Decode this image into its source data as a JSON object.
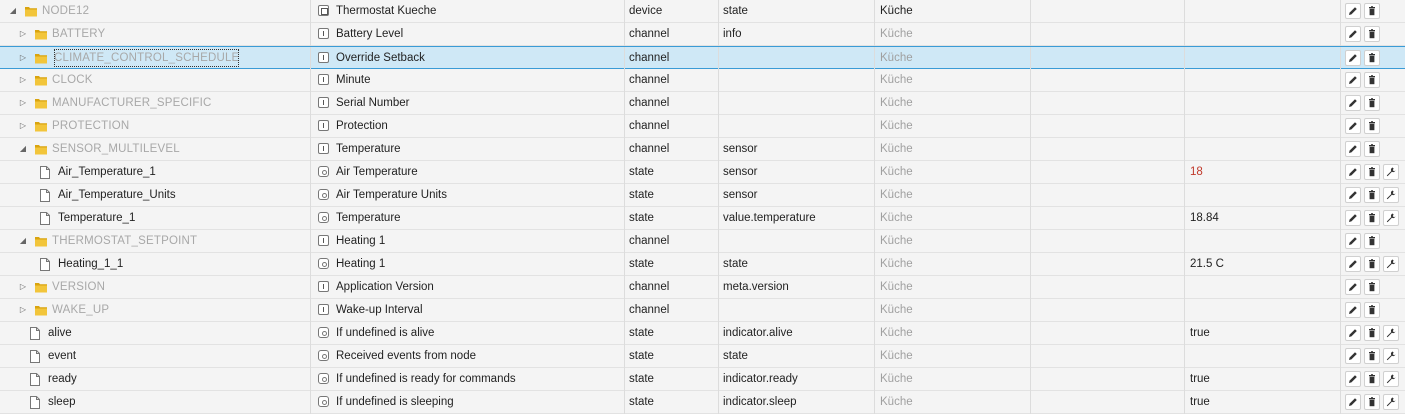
{
  "rows": [
    {
      "id": "NODE12",
      "kind": "folder",
      "level": 0,
      "toggle": "open",
      "dim": true,
      "icon": "device-icon",
      "name": "Thermostat Kueche",
      "type": "device",
      "role": "state",
      "room": "Küche",
      "room_dim": false,
      "value": "",
      "actions": [
        "edit",
        "delete"
      ]
    },
    {
      "id": "BATTERY",
      "kind": "folder",
      "level": 1,
      "toggle": "closed",
      "dim": true,
      "icon": "channel-icon",
      "name": "Battery Level",
      "type": "channel",
      "role": "info",
      "room": "Küche",
      "room_dim": true,
      "value": "",
      "actions": [
        "edit",
        "delete"
      ]
    },
    {
      "id": "CLIMATE_CONTROL_SCHEDULE",
      "kind": "folder",
      "level": 1,
      "toggle": "closed",
      "dim": true,
      "focus": true,
      "selected": true,
      "icon": "channel-icon",
      "name": "Override Setback",
      "type": "channel",
      "role": "",
      "room": "Küche",
      "room_dim": true,
      "value": "",
      "actions": [
        "edit",
        "delete"
      ]
    },
    {
      "id": "CLOCK",
      "kind": "folder",
      "level": 1,
      "toggle": "closed",
      "dim": true,
      "icon": "channel-icon",
      "name": "Minute",
      "type": "channel",
      "role": "",
      "room": "Küche",
      "room_dim": true,
      "value": "",
      "actions": [
        "edit",
        "delete"
      ]
    },
    {
      "id": "MANUFACTURER_SPECIFIC",
      "kind": "folder",
      "level": 1,
      "toggle": "closed",
      "dim": true,
      "icon": "channel-icon",
      "name": "Serial Number",
      "type": "channel",
      "role": "",
      "room": "Küche",
      "room_dim": true,
      "value": "",
      "actions": [
        "edit",
        "delete"
      ]
    },
    {
      "id": "PROTECTION",
      "kind": "folder",
      "level": 1,
      "toggle": "closed",
      "dim": true,
      "icon": "channel-icon",
      "name": "Protection",
      "type": "channel",
      "role": "",
      "room": "Küche",
      "room_dim": true,
      "value": "",
      "actions": [
        "edit",
        "delete"
      ]
    },
    {
      "id": "SENSOR_MULTILEVEL",
      "kind": "folder",
      "level": 1,
      "toggle": "open",
      "dim": true,
      "icon": "channel-icon",
      "name": "Temperature",
      "type": "channel",
      "role": "sensor",
      "room": "Küche",
      "room_dim": true,
      "value": "",
      "actions": [
        "edit",
        "delete"
      ]
    },
    {
      "id": "Air_Temperature_1",
      "kind": "file",
      "level": 2,
      "dim": false,
      "icon": "state-icon",
      "name": "Air Temperature",
      "type": "state",
      "role": "sensor",
      "room": "Küche",
      "room_dim": true,
      "value": "18",
      "value_red": true,
      "actions": [
        "edit",
        "delete",
        "settings"
      ]
    },
    {
      "id": "Air_Temperature_Units",
      "kind": "file",
      "level": 2,
      "dim": false,
      "icon": "state-icon",
      "name": "Air Temperature Units",
      "type": "state",
      "role": "sensor",
      "room": "Küche",
      "room_dim": true,
      "value": "",
      "actions": [
        "edit",
        "delete",
        "settings"
      ]
    },
    {
      "id": "Temperature_1",
      "kind": "file",
      "level": 2,
      "dim": false,
      "icon": "state-icon",
      "name": "Temperature",
      "type": "state",
      "role": "value.temperature",
      "room": "Küche",
      "room_dim": true,
      "value": "18.84",
      "actions": [
        "edit",
        "delete",
        "settings"
      ]
    },
    {
      "id": "THERMOSTAT_SETPOINT",
      "kind": "folder",
      "level": 1,
      "toggle": "open",
      "dim": true,
      "icon": "channel-icon",
      "name": "Heating 1",
      "type": "channel",
      "role": "",
      "room": "Küche",
      "room_dim": true,
      "value": "",
      "actions": [
        "edit",
        "delete"
      ]
    },
    {
      "id": "Heating_1_1",
      "kind": "file",
      "level": 2,
      "dim": false,
      "icon": "state-icon",
      "name": "Heating 1",
      "type": "state",
      "role": "state",
      "room": "Küche",
      "room_dim": true,
      "value": "21.5 C",
      "actions": [
        "edit",
        "delete",
        "settings"
      ]
    },
    {
      "id": "VERSION",
      "kind": "folder",
      "level": 1,
      "toggle": "closed",
      "dim": true,
      "icon": "channel-icon",
      "name": "Application Version",
      "type": "channel",
      "role": "meta.version",
      "room": "Küche",
      "room_dim": true,
      "value": "",
      "actions": [
        "edit",
        "delete"
      ]
    },
    {
      "id": "WAKE_UP",
      "kind": "folder",
      "level": 1,
      "toggle": "closed",
      "dim": true,
      "icon": "channel-icon",
      "name": "Wake-up Interval",
      "type": "channel",
      "role": "",
      "room": "Küche",
      "room_dim": true,
      "value": "",
      "actions": [
        "edit",
        "delete"
      ]
    },
    {
      "id": "alive",
      "kind": "file",
      "level": 1,
      "dim": false,
      "icon": "state-icon",
      "name": "If undefined is alive",
      "type": "state",
      "role": "indicator.alive",
      "room": "Küche",
      "room_dim": true,
      "value": "true",
      "actions": [
        "edit",
        "delete",
        "settings"
      ]
    },
    {
      "id": "event",
      "kind": "file",
      "level": 1,
      "dim": false,
      "icon": "state-icon",
      "name": "Received events from node",
      "type": "state",
      "role": "state",
      "room": "Küche",
      "room_dim": true,
      "value": "",
      "actions": [
        "edit",
        "delete",
        "settings"
      ]
    },
    {
      "id": "ready",
      "kind": "file",
      "level": 1,
      "dim": false,
      "icon": "state-icon",
      "name": "If undefined is ready for commands",
      "type": "state",
      "role": "indicator.ready",
      "room": "Küche",
      "room_dim": true,
      "value": "true",
      "actions": [
        "edit",
        "delete",
        "settings"
      ]
    },
    {
      "id": "sleep",
      "kind": "file",
      "level": 1,
      "dim": false,
      "icon": "state-icon",
      "name": "If undefined is sleeping",
      "type": "state",
      "role": "indicator.sleep",
      "room": "Küche",
      "room_dim": true,
      "value": "true",
      "actions": [
        "edit",
        "delete",
        "settings"
      ]
    }
  ],
  "colors": {
    "folder": "#e8b92a",
    "selected_bg": "#cfe8f6",
    "selected_border": "#3a9bd6",
    "value_red": "#c0392b"
  }
}
